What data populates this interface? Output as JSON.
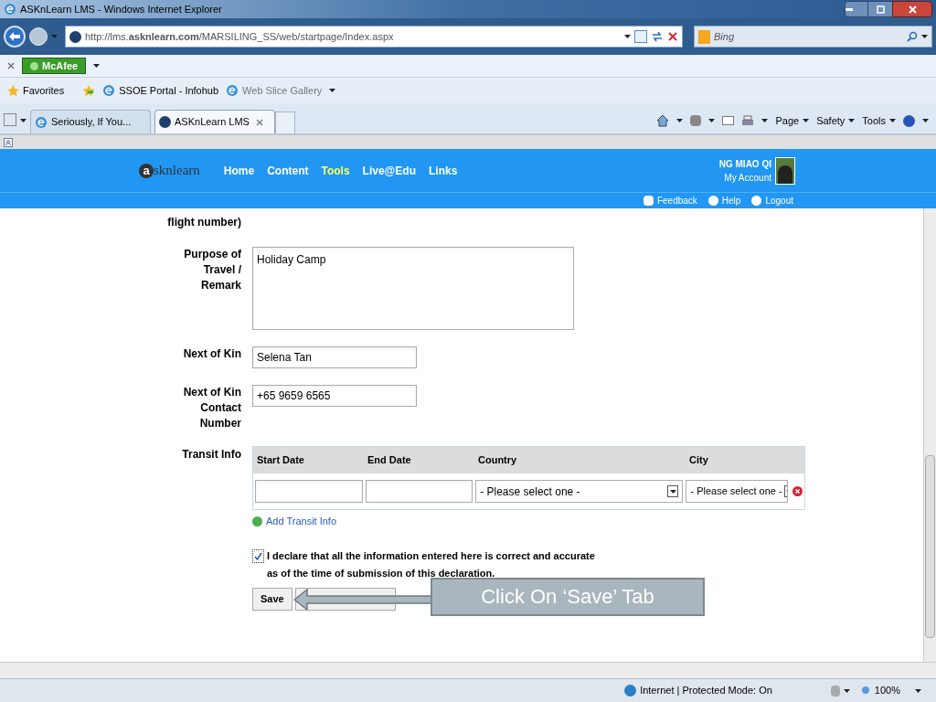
{
  "window": {
    "title": "ASKnLearn LMS - Windows Internet Explorer"
  },
  "address_bar": {
    "url": "http://lms.**asknlearn.com**/MARSILING_SS/web/startpage/Index.aspx",
    "search_placeholder": "Bing"
  },
  "mcafee": "McAfee",
  "favorites": {
    "label": "Favorites",
    "links": [
      "SSOE Portal - Infohub",
      "Web Slice Gallery"
    ]
  },
  "tabs": [
    {
      "label": "Seriously, If You...",
      "selected": false
    },
    {
      "label": "ASKnLearn LMS",
      "selected": true
    }
  ],
  "command_bar": [
    "Page",
    "Safety",
    "Tools"
  ],
  "site": {
    "logo_mark": "a",
    "logo": "sknlearn",
    "nav": [
      {
        "label": "Home",
        "selected": false
      },
      {
        "label": "Content",
        "selected": false
      },
      {
        "label": "Tools",
        "selected": true
      },
      {
        "label": "Live@Edu",
        "selected": false
      },
      {
        "label": "Links",
        "selected": false
      }
    ],
    "user": "NG MIAO QI",
    "account": "My Account",
    "links": [
      "Feedback",
      "Help",
      "Logout"
    ]
  },
  "form": {
    "cut_label": "flight number)",
    "fields": [
      {
        "kind": "textarea",
        "label": "Purpose of Travel / Remark",
        "value": "Holiday Camp"
      },
      {
        "kind": "input",
        "label": "Next of Kin",
        "value": "Selena Tan"
      },
      {
        "kind": "input",
        "label": "Next of Kin Contact Number",
        "value": "+65 9659 6565"
      }
    ],
    "transit": {
      "label": "Transit Info",
      "columns": [
        "Start Date",
        "End Date",
        "Country",
        "City"
      ],
      "country": "- Please select one -",
      "city": "- Please select one -",
      "add": "Add Transit Info"
    },
    "declaration": {
      "checked": true,
      "text": "I declare that all the information entered here is correct and accurate\nas of the time of submission of this declaration."
    },
    "save": "Save"
  },
  "callout": "Click On ‘Save’ Tab",
  "status": {
    "zone": "Internet | Protected Mode: On",
    "zoom": "100%"
  }
}
